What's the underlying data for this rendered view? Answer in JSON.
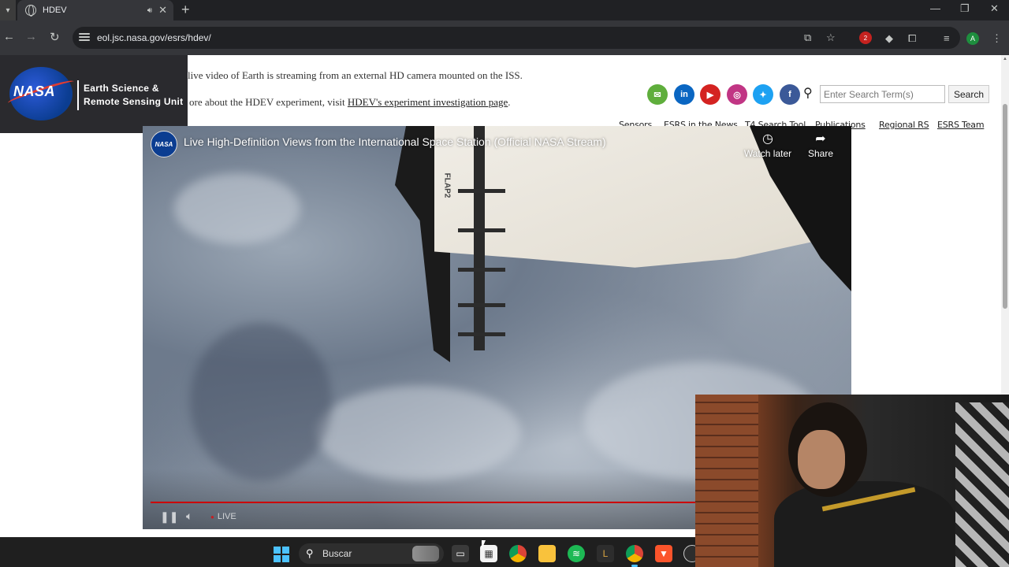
{
  "browser": {
    "tab_title": "HDEV",
    "url": "eol.jsc.nasa.gov/esrs/hdev/",
    "new_tab_label": "+",
    "profile_initial": "A",
    "extension_badge": "2"
  },
  "header": {
    "logo_word": "NASA",
    "unit_line1": "Earth Science &",
    "unit_line2": "Remote Sensing Unit",
    "intro_line1": "live video of Earth is streaming from an external HD camera mounted on the ISS.",
    "intro_line2_prefix": "ore about the HDEV experiment, visit ",
    "intro_line2_link": "HDEV's experiment investigation page",
    "intro_line2_suffix": ".",
    "social_icons": [
      "email-icon",
      "linkedin-icon",
      "youtube-icon",
      "instagram-icon",
      "twitter-icon",
      "facebook-icon"
    ],
    "social_colors": [
      "#5fae3c",
      "#0a66c2",
      "#d42321",
      "#c13584",
      "#1da1f2",
      "#3b5998"
    ],
    "search_placeholder": "Enter Search Term(s)",
    "search_button": "Search",
    "nav": [
      "Sensors",
      "ESRS in the News",
      "T4 Search Tool",
      "Publications",
      "Regional RS",
      "ESRS Team"
    ]
  },
  "video": {
    "channel_badge": "NASA",
    "title": "Live High-Definition Views from the International Space Station (Official NASA Stream)",
    "watch_later": "Watch later",
    "share": "Share",
    "live_label": "LIVE",
    "flap_label": "FLAP2"
  },
  "taskbar": {
    "search_text": "Buscar",
    "apps": [
      "task-view-icon",
      "store-icon",
      "chrome-icon",
      "file-explorer-icon",
      "spotify-icon",
      "app-icon",
      "chrome-profile-icon",
      "brave-icon",
      "clock-icon"
    ]
  }
}
